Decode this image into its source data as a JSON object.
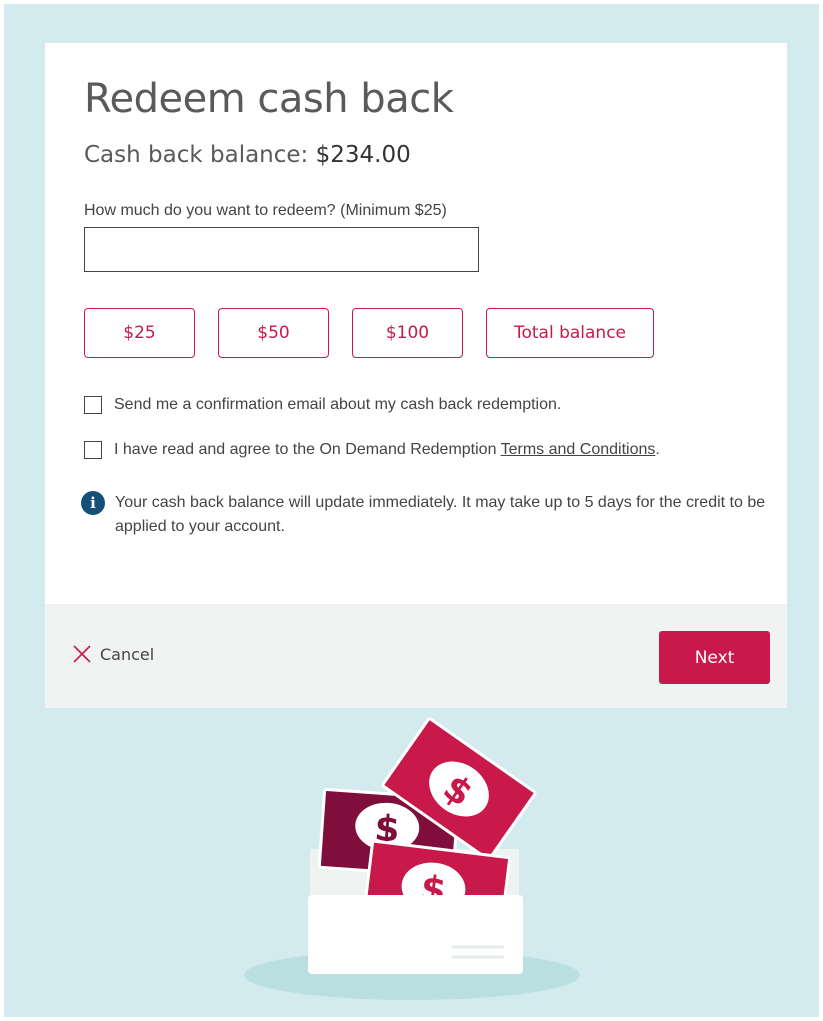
{
  "page": {
    "title": "Redeem cash back",
    "balance_label": "Cash back balance:",
    "balance_value": "$234.00"
  },
  "form": {
    "amount_label": "How much do you want to redeem? (Minimum $25)",
    "amount_value": "",
    "amount_placeholder": "",
    "presets": [
      "$25",
      "$50",
      "$100",
      "Total balance"
    ],
    "confirm_email": {
      "label": "Send me a confirmation email about my cash back redemption.",
      "checked": false
    },
    "terms": {
      "label_prefix": "I have read and agree to the On Demand Redemption ",
      "link_text": "Terms and Conditions",
      "label_suffix": ".",
      "checked": false
    },
    "info_icon": "info-icon",
    "info_text": "Your cash back balance will update immediately. It may take up to 5 days for the credit to be applied to your account."
  },
  "footer": {
    "cancel_icon": "close-icon",
    "cancel_label": "Cancel",
    "next_label": "Next"
  },
  "illustration": {
    "dollar_sign": "$"
  },
  "colors": {
    "background": "#d3ebee",
    "accent": "#c8194a",
    "accent_dark": "#7f0f3a",
    "info_blue": "#16507a",
    "footer_bg": "#f1f3f2"
  }
}
